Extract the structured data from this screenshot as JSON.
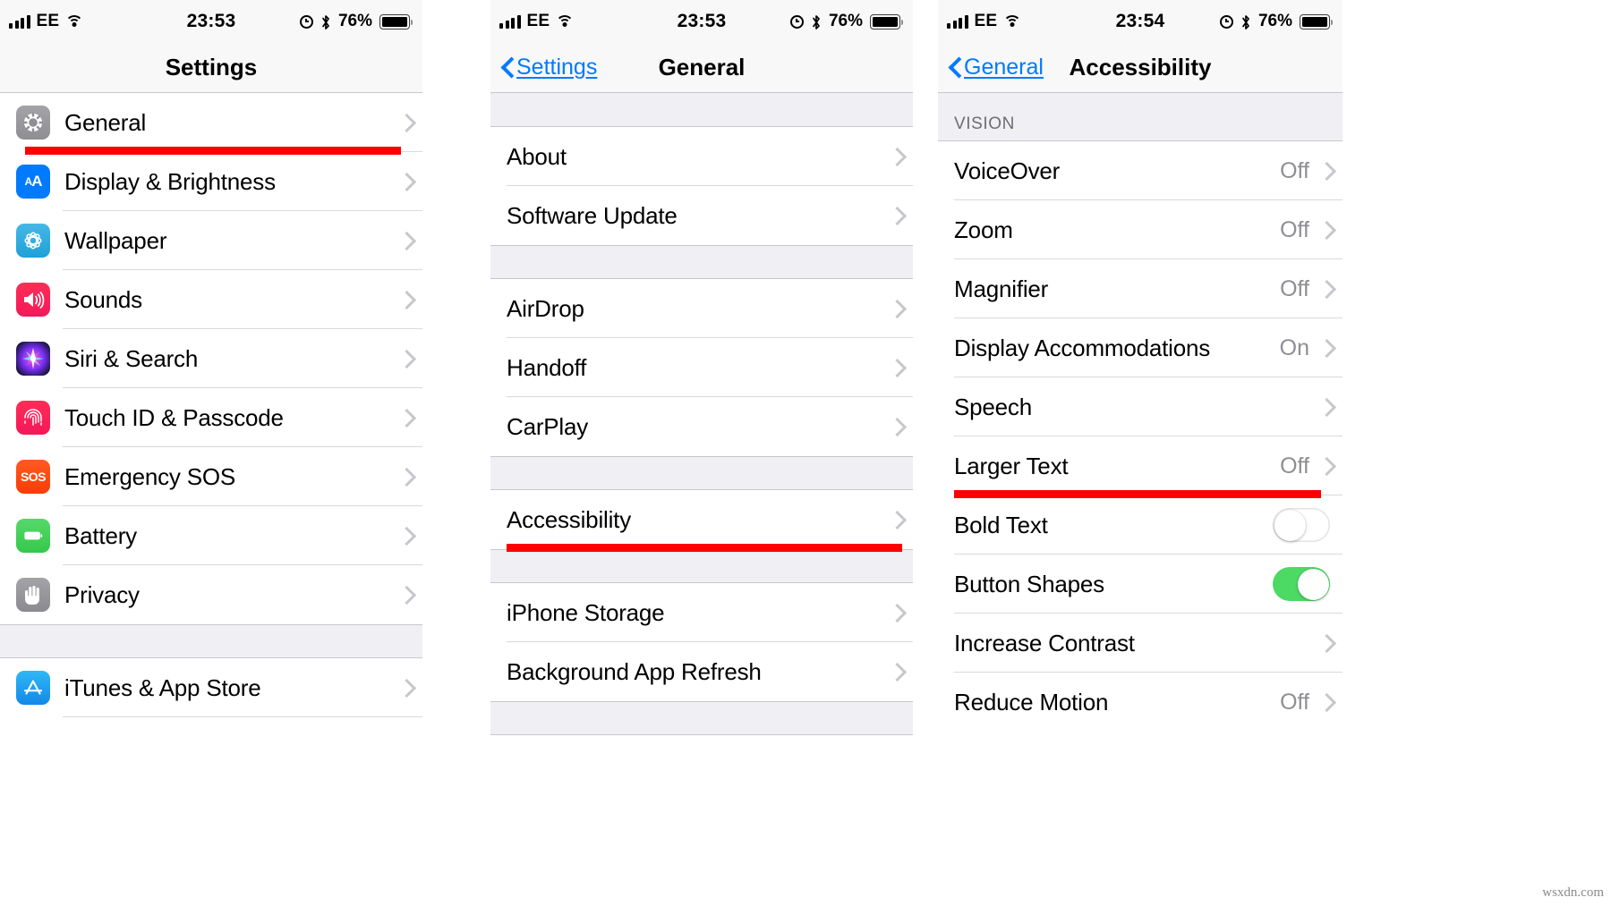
{
  "watermark": "wsxdn.com",
  "panels": [
    {
      "id": "settings",
      "status": {
        "carrier": "EE",
        "time": "23:53",
        "battery_pct": "76%"
      },
      "nav": {
        "title": "Settings",
        "back": null
      },
      "sections": [
        {
          "type": "rows",
          "rows": [
            {
              "label": "General",
              "icon": "gear-icon",
              "icon_class": "ic-gear",
              "accessory": "chevron",
              "highlight": true
            },
            {
              "label": "Display & Brightness",
              "icon": "text-size-icon",
              "icon_class": "ic-display",
              "accessory": "chevron"
            },
            {
              "label": "Wallpaper",
              "icon": "wallpaper-icon",
              "icon_class": "ic-wall",
              "accessory": "chevron"
            },
            {
              "label": "Sounds",
              "icon": "speaker-icon",
              "icon_class": "ic-sounds",
              "accessory": "chevron"
            },
            {
              "label": "Siri & Search",
              "icon": "siri-icon",
              "icon_class": "ic-siri",
              "accessory": "chevron"
            },
            {
              "label": "Touch ID & Passcode",
              "icon": "fingerprint-icon",
              "icon_class": "ic-touch",
              "accessory": "chevron"
            },
            {
              "label": "Emergency SOS",
              "icon": "sos-icon",
              "icon_class": "ic-sos",
              "accessory": "chevron"
            },
            {
              "label": "Battery",
              "icon": "battery-icon",
              "icon_class": "ic-batt",
              "accessory": "chevron"
            },
            {
              "label": "Privacy",
              "icon": "hand-icon",
              "icon_class": "ic-priv",
              "accessory": "chevron",
              "last": true
            }
          ]
        },
        {
          "type": "spacer"
        },
        {
          "type": "rows",
          "rows": [
            {
              "label": "iTunes & App Store",
              "icon": "app-store-icon",
              "icon_class": "ic-appstore",
              "accessory": "chevron"
            }
          ]
        }
      ]
    },
    {
      "id": "general",
      "status": {
        "carrier": "EE",
        "time": "23:53",
        "battery_pct": "76%"
      },
      "nav": {
        "title": "General",
        "back": "Settings"
      },
      "sections": [
        {
          "type": "spacer",
          "first": true
        },
        {
          "type": "rows",
          "rows": [
            {
              "label": "About",
              "accessory": "chevron"
            },
            {
              "label": "Software Update",
              "accessory": "chevron",
              "last": true
            }
          ]
        },
        {
          "type": "spacer"
        },
        {
          "type": "rows",
          "rows": [
            {
              "label": "AirDrop",
              "accessory": "chevron"
            },
            {
              "label": "Handoff",
              "accessory": "chevron"
            },
            {
              "label": "CarPlay",
              "accessory": "chevron",
              "last": true
            }
          ]
        },
        {
          "type": "spacer"
        },
        {
          "type": "rows",
          "rows": [
            {
              "label": "Accessibility",
              "accessory": "chevron",
              "highlight": true,
              "last": true
            }
          ]
        },
        {
          "type": "spacer"
        },
        {
          "type": "rows",
          "rows": [
            {
              "label": "iPhone Storage",
              "accessory": "chevron"
            },
            {
              "label": "Background App Refresh",
              "accessory": "chevron",
              "last": true
            }
          ]
        },
        {
          "type": "spacer"
        }
      ]
    },
    {
      "id": "accessibility",
      "status": {
        "carrier": "EE",
        "time": "23:54",
        "battery_pct": "76%"
      },
      "nav": {
        "title": "Accessibility",
        "back": "General"
      },
      "sections": [
        {
          "type": "group_header",
          "label": "VISION"
        },
        {
          "type": "rows",
          "rows": [
            {
              "label": "VoiceOver",
              "value": "Off",
              "accessory": "chevron"
            },
            {
              "label": "Zoom",
              "value": "Off",
              "accessory": "chevron"
            },
            {
              "label": "Magnifier",
              "value": "Off",
              "accessory": "chevron"
            },
            {
              "label": "Display Accommodations",
              "value": "On",
              "accessory": "chevron"
            },
            {
              "label": "Speech",
              "accessory": "chevron"
            },
            {
              "label": "Larger Text",
              "value": "Off",
              "accessory": "chevron",
              "highlight": true
            },
            {
              "label": "Bold Text",
              "accessory": "toggle",
              "toggle_on": false
            },
            {
              "label": "Button Shapes",
              "accessory": "toggle",
              "toggle_on": true
            },
            {
              "label": "Increase Contrast",
              "accessory": "chevron"
            },
            {
              "label": "Reduce Motion",
              "value": "Off",
              "accessory": "chevron",
              "last": true
            }
          ]
        }
      ]
    }
  ],
  "colors": {
    "accent_blue": "#007aff",
    "highlight_red": "#ff0000",
    "toggle_green": "#4cd964",
    "group_bg": "#efeff4",
    "value_gray": "#8e8e93"
  }
}
